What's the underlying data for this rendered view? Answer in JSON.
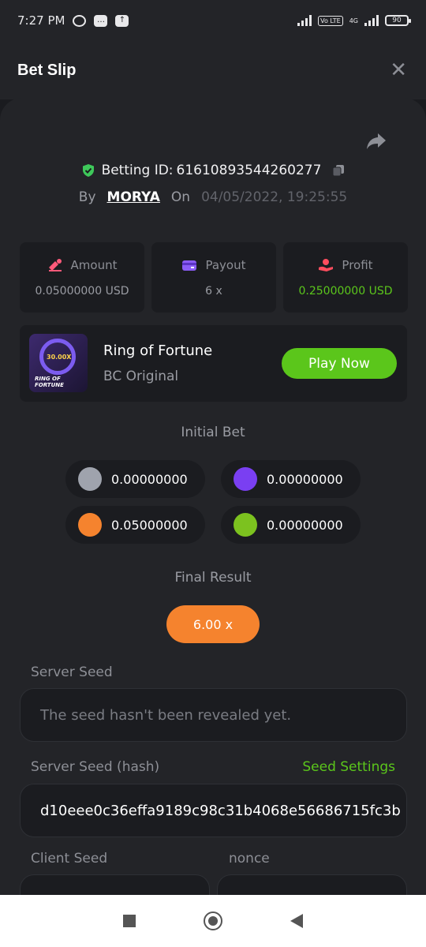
{
  "status_bar": {
    "time": "7:27 PM",
    "network_tag": "Vo LTE",
    "network_gen": "4G",
    "battery": "90"
  },
  "header": {
    "title": "Bet Slip",
    "close_icon": "✕"
  },
  "bet": {
    "id_label": "Betting ID:",
    "id": "61610893544260277",
    "by_label": "By",
    "user": "MORYA",
    "on_label": "On",
    "date": "04/05/2022, 19:25:55"
  },
  "stats": {
    "amount": {
      "label": "Amount",
      "value": "0.05000000 USD"
    },
    "payout": {
      "label": "Payout",
      "value": "6 x"
    },
    "profit": {
      "label": "Profit",
      "value": "0.25000000 USD"
    }
  },
  "game": {
    "name": "Ring of Fortune",
    "provider": "BC Original",
    "play_label": "Play Now",
    "thumb_multiplier": "30.00X",
    "thumb_title_1": "RING OF",
    "thumb_title_2": "FORTUNE"
  },
  "initial_bet": {
    "label": "Initial Bet",
    "chips": [
      {
        "color": "#9fa3ad",
        "value": "0.00000000"
      },
      {
        "color": "#7a3ff2",
        "value": "0.00000000"
      },
      {
        "color": "#f5832e",
        "value": "0.05000000"
      },
      {
        "color": "#7cc21f",
        "value": "0.00000000"
      }
    ]
  },
  "final_result": {
    "label": "Final Result",
    "value": "6.00 x"
  },
  "server_seed": {
    "label": "Server Seed",
    "placeholder": "The seed hasn't been revealed yet."
  },
  "server_seed_hash": {
    "label": "Server Seed (hash)",
    "link": "Seed Settings",
    "value": "d10eee0c36effa9189c98c31b4068e56686715fc3b"
  },
  "client_seed": {
    "label": "Client Seed"
  },
  "nonce": {
    "label": "nonce"
  },
  "colors": {
    "accent_green": "#5bc61b",
    "accent_orange": "#f5832e",
    "background": "#1a1b1f",
    "card": "#232428"
  }
}
